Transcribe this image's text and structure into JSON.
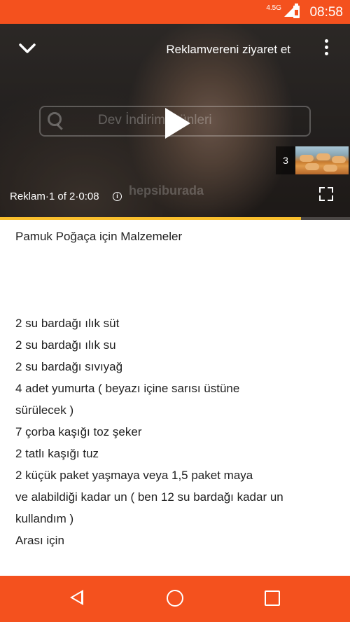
{
  "status_bar": {
    "network": "4.5G",
    "time": "08:58"
  },
  "ad_player": {
    "visit_advertiser_label": "Reklamvereni ziyaret et",
    "search_banner_text": "Dev İndirim Günleri",
    "brand_watermark": "hepsiburada",
    "ad_counter": "Reklam·1 of 2·0:08",
    "next_thumbnail_count": "3",
    "progress_fraction": 0.86,
    "progress_color": "#f9bf2d"
  },
  "recipe": {
    "title": "Pamuk Poğaça için Malzemeler",
    "lines": [
      "2 su bardağı ılık süt",
      "2 su bardağı ılık su",
      "2 su bardağı sıvıyağ",
      "4 adet yumurta ( beyazı içine sarısı üstüne",
      "sürülecek )",
      "7 çorba kaşığı toz şeker",
      "2 tatlı kaşığı tuz",
      "2 küçük paket yaşmaya veya 1,5 paket maya",
      "ve alabildiği kadar un ( ben 12 su bardağı kadar un",
      "kullandım )",
      "Arası için"
    ]
  },
  "nav_bar": {
    "icons": [
      "back-icon",
      "home-icon",
      "recent-apps-icon"
    ]
  },
  "colors": {
    "accent": "#f4511e",
    "text": "#1f1f1f"
  }
}
